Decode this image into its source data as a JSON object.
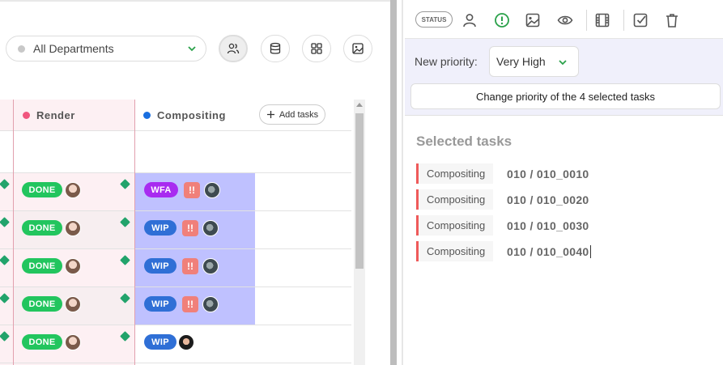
{
  "toolbar": {
    "department_filter": "All Departments",
    "buttons": [
      "people-icon",
      "database-icon",
      "grid-icon",
      "image-icon"
    ]
  },
  "table": {
    "columns": [
      {
        "name": "Render",
        "color": "#f0567e"
      },
      {
        "name": "Compositing",
        "color": "#1a6fe0"
      }
    ],
    "add_tasks_label": "Add tasks",
    "rows": [
      {
        "render_status": "DONE",
        "comp_status": "WFA",
        "comp_priority": "!!"
      },
      {
        "render_status": "DONE",
        "comp_status": "WIP",
        "comp_priority": "!!"
      },
      {
        "render_status": "DONE",
        "comp_status": "WIP",
        "comp_priority": "!!"
      },
      {
        "render_status": "DONE",
        "comp_status": "WIP",
        "comp_priority": "!!"
      },
      {
        "render_status": "DONE",
        "comp_status": "WIP",
        "comp_priority": ""
      }
    ]
  },
  "action_panel": {
    "status_label": "STATUS",
    "icons": [
      "person-icon",
      "priority-icon",
      "image-icon",
      "eye-icon",
      "film-icon",
      "checkbox-icon",
      "trash-icon"
    ],
    "new_priority_label": "New priority:",
    "priority_value": "Very High",
    "change_button": "Change priority of the 4 selected tasks",
    "selected_title": "Selected tasks",
    "selected_tasks": [
      {
        "type": "Compositing",
        "name": "010 / 010_0010"
      },
      {
        "type": "Compositing",
        "name": "010 / 010_0020"
      },
      {
        "type": "Compositing",
        "name": "010 / 010_0030"
      },
      {
        "type": "Compositing",
        "name": "010 / 010_0040"
      }
    ]
  },
  "colors": {
    "done": "#22c55e",
    "wfa": "#a82bf0",
    "wip": "#2f6fd6",
    "priority": "#f0807a",
    "selected_cell": "#bfc1ff",
    "accent_green": "#2aa14a"
  }
}
